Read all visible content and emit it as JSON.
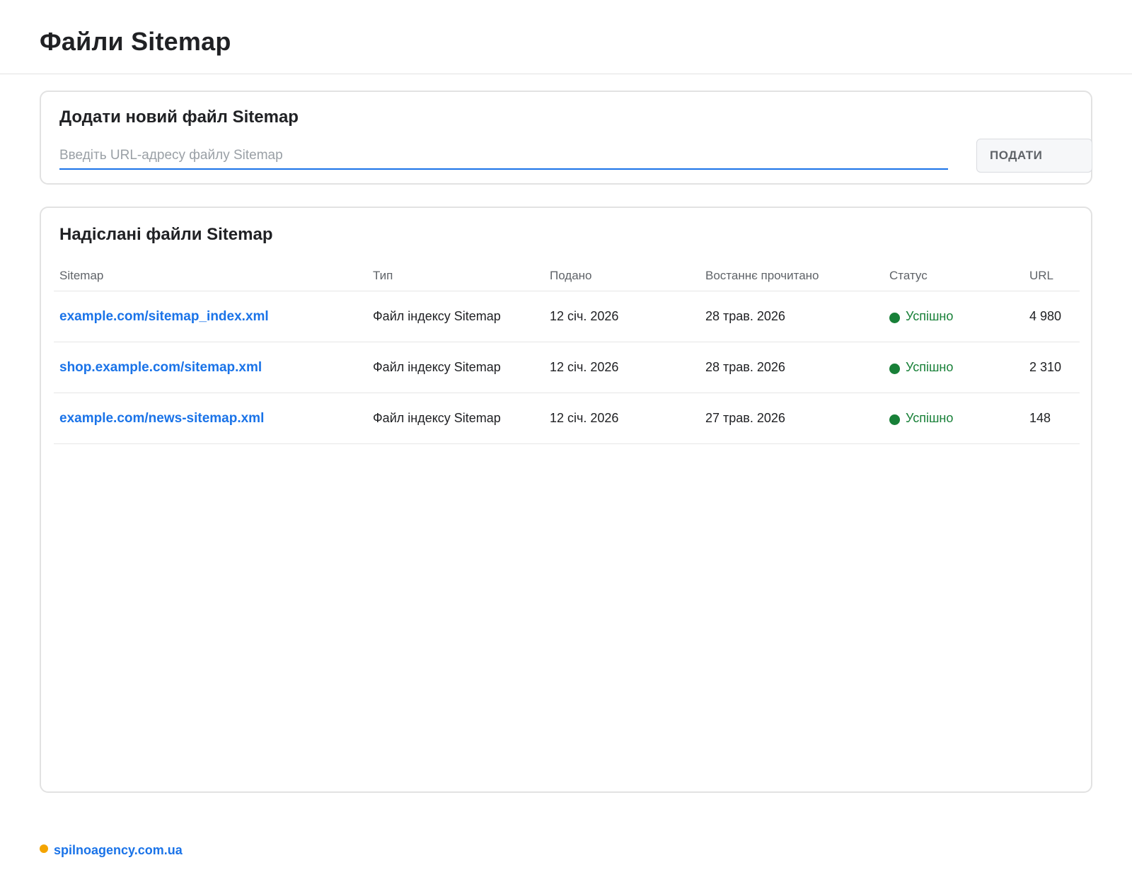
{
  "header": {
    "title": "Файли Sitemap"
  },
  "add_card": {
    "title": "Додати новий файл Sitemap",
    "input_placeholder": "Введіть URL-адресу файлу Sitemap",
    "input_value": "",
    "submit_label": "ПОДАТИ"
  },
  "list_card": {
    "title": "Надіслані файли Sitemap",
    "columns": [
      "Sitemap",
      "Тип",
      "Подано",
      "Востаннє прочитано",
      "Статус",
      "URL"
    ],
    "rows": [
      {
        "sitemap": "example.com/sitemap_index.xml",
        "type": "Файл індексу Sitemap",
        "submitted": "12 січ. 2026",
        "last_read": "28 трав. 2026",
        "status": "Успішно",
        "urls": "4 980"
      },
      {
        "sitemap": "shop.example.com/sitemap.xml",
        "type": "Файл індексу Sitemap",
        "submitted": "12 січ. 2026",
        "last_read": "28 трав. 2026",
        "status": "Успішно",
        "urls": "2 310"
      },
      {
        "sitemap": "example.com/news-sitemap.xml",
        "type": "Файл індексу Sitemap",
        "submitted": "12 січ. 2026",
        "last_read": "27 трав. 2026",
        "status": "Успішно",
        "urls": "148"
      }
    ]
  },
  "footer": {
    "brand": "spilnoagency.com.ua"
  },
  "colors": {
    "accent": "#1a73e8",
    "success": "#188038",
    "brand_dot": "#f4a400"
  }
}
